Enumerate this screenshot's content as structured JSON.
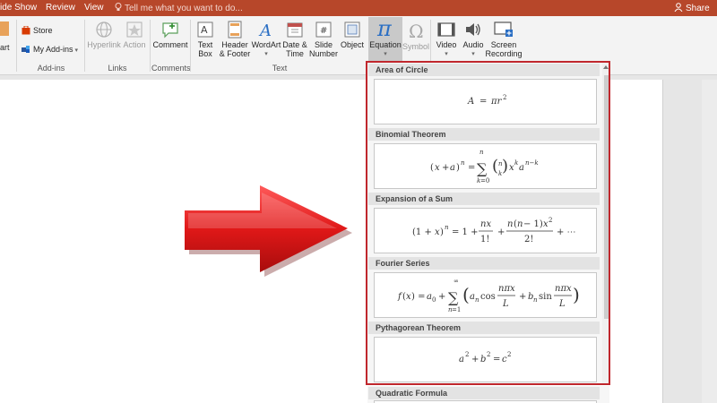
{
  "tabs": {
    "slide_show": "ide Show",
    "review": "Review",
    "view": "View",
    "tell_me": "Tell me what you want to do...",
    "share": "Share"
  },
  "ribbon": {
    "cut_label": "art",
    "store_label": "Store",
    "my_addins_label": "My Add-ins",
    "addins_group": "Add-ins",
    "hyperlink": "Hyperlink",
    "action": "Action",
    "links_group": "Links",
    "comment": "Comment",
    "comments_group": "Comments",
    "text_box": [
      "Text",
      "Box"
    ],
    "header_footer": [
      "Header",
      "& Footer"
    ],
    "wordart": "WordArt",
    "date_time": [
      "Date &",
      "Time"
    ],
    "slide_number": [
      "Slide",
      "Number"
    ],
    "object": "Object",
    "text_group": "Text",
    "equation": "Equation",
    "symbol": "Symbol",
    "video": "Video",
    "audio": "Audio",
    "screen_recording": [
      "Screen",
      "Recording"
    ]
  },
  "equations": {
    "area_circle": "Area of Circle",
    "binomial": "Binomial Theorem",
    "expansion": "Expansion of a Sum",
    "fourier": "Fourier Series",
    "pythagorean": "Pythagorean Theorem",
    "quadratic": "Quadratic Formula"
  },
  "colors": {
    "accent": "#b7472a",
    "highlight_border": "#c0272d",
    "arrow": "#e01818"
  }
}
